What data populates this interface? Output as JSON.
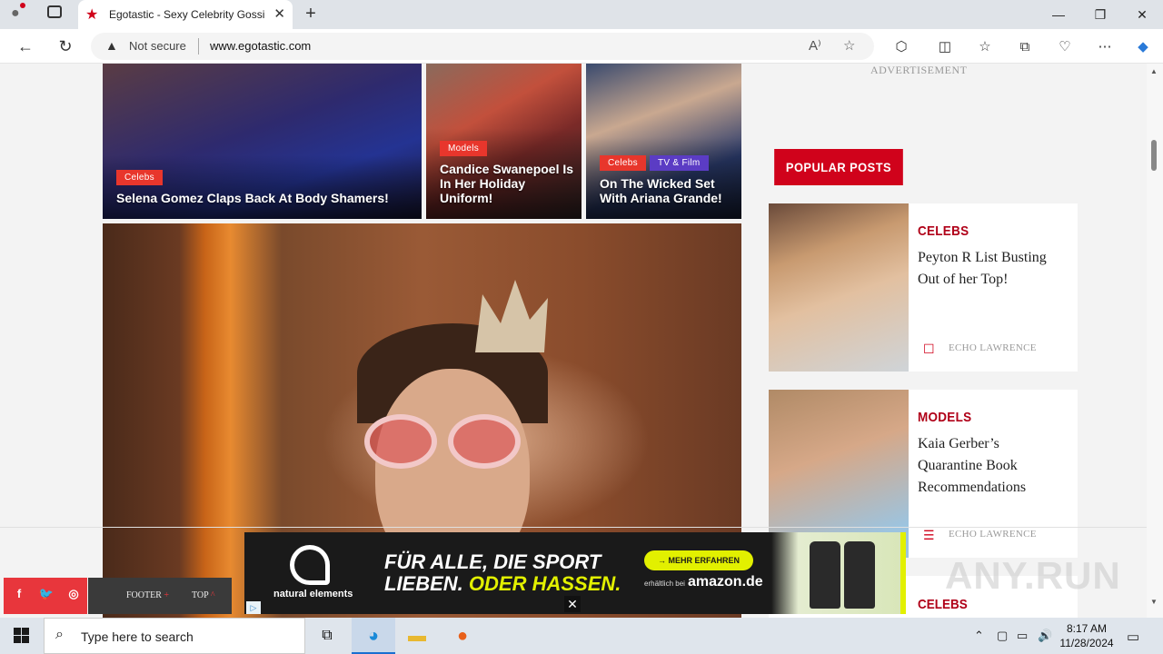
{
  "browser": {
    "tab_title": "Egotastic - Sexy Celebrity Gossip",
    "security_label": "Not secure",
    "url": "www.egotastic.com"
  },
  "page": {
    "cards": [
      {
        "category": "Celebs",
        "title": "Selena Gomez Claps Back At Body Shamers!"
      },
      {
        "category": "Models",
        "title": "Candice Swanepoel Is In Her Holiday Uniform!"
      },
      {
        "categories": [
          "Celebs",
          "TV & Film"
        ],
        "title": "On The Wicked Set With Ariana Grande!"
      }
    ],
    "sidebar": {
      "ad_label": "ADVERTISEMENT",
      "popular_heading": "POPULAR POSTS",
      "posts": [
        {
          "category": "CELEBS",
          "title": "Peyton R List Busting Out of her Top!",
          "author": "ECHO LAWRENCE"
        },
        {
          "category": "MODELS",
          "title": "Kaia Gerber’s Quarantine Book Recommendations",
          "author": "ECHO LAWRENCE"
        },
        {
          "category": "CELEBS"
        }
      ]
    },
    "footer_bar": {
      "footer_label": "FOOTER",
      "top_label": "TOP"
    },
    "ad": {
      "brand": "natural elements",
      "headline_1": "FÜR ALLE, DIE SPORT",
      "headline_2a": "LIEBEN.",
      "headline_2b": "ODER HASSEN.",
      "cta": "→ MEHR ERFAHREN",
      "small_text": "erhältlich bei",
      "retailer": "amazon.de"
    },
    "watermark": "ANY.RUN"
  },
  "taskbar": {
    "search_placeholder": "Type here to search",
    "time": "8:17 AM",
    "date": "11/28/2024"
  }
}
